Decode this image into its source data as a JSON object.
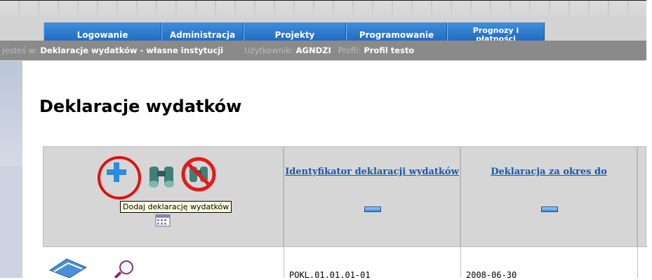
{
  "nav": {
    "items": [
      {
        "label": "Logowanie"
      },
      {
        "label": "Administracja"
      },
      {
        "label": "Projekty"
      },
      {
        "label": "Programowanie"
      },
      {
        "label": "Prognozy i płatności"
      }
    ]
  },
  "breadcrumb": {
    "location_label": "Jesteś w:",
    "location_value": "Deklaracje wydatków - własne instytucji",
    "user_label": "Użytkownik:",
    "user_value": "AGNDZI",
    "profile_label": "Profil:",
    "profile_value": "Profil testo"
  },
  "page": {
    "title": "Deklaracje wydatków"
  },
  "table": {
    "columns": [
      {
        "label": "Identyfikator deklaracji wydatków"
      },
      {
        "label": "Deklaracja za okres do"
      }
    ],
    "rows": [
      {
        "id": "POKL.01.01.01-01",
        "period": "2008-06-30"
      }
    ]
  },
  "tooltip": {
    "text": "Dodaj deklarację wydatków"
  },
  "icons": {
    "add": "plus-icon",
    "search": "binoculars-icon",
    "clear": "binoculars-crossed-icon",
    "calendar": "calendar-icon",
    "view": "book-icon",
    "details": "magnifier-icon"
  },
  "colors": {
    "nav_bg": "#2a73c6",
    "link": "#1a58a8",
    "highlight": "#e01010",
    "breadcrumb_bg": "#8a8a8a"
  }
}
